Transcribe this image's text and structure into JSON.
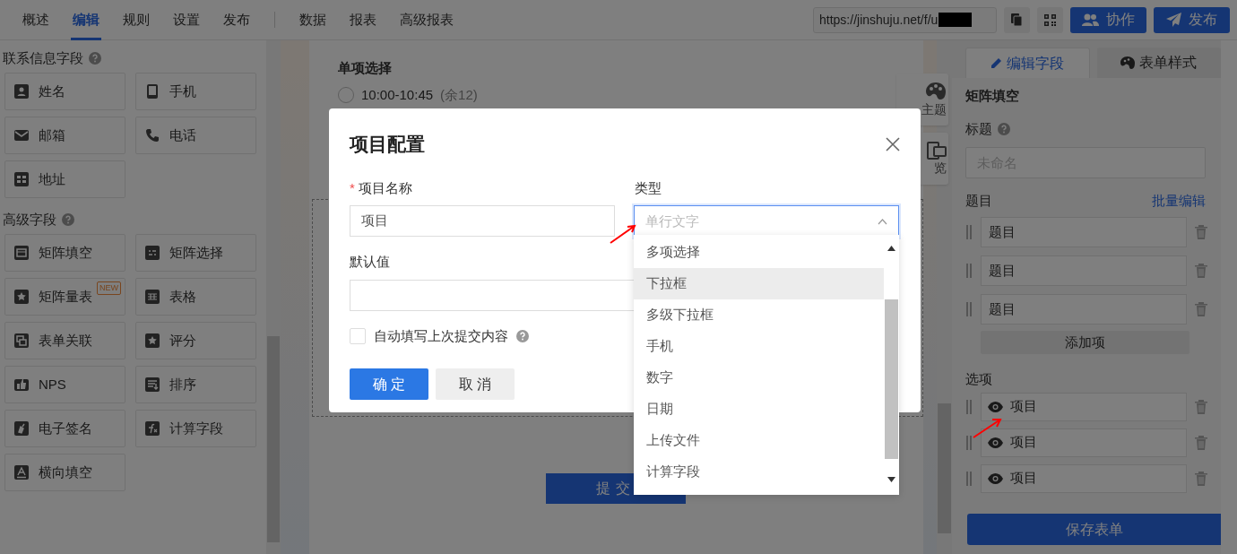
{
  "nav": {
    "primary_tabs": [
      {
        "label": "概述",
        "selected": false
      },
      {
        "label": "编辑",
        "selected": true
      },
      {
        "label": "规则",
        "selected": false
      },
      {
        "label": "设置",
        "selected": false
      },
      {
        "label": "发布",
        "selected": false
      }
    ],
    "data_tabs": [
      {
        "label": "数据",
        "selected": false
      },
      {
        "label": "报表",
        "selected": false
      },
      {
        "label": "高级报表",
        "selected": false
      }
    ],
    "url": "https://jinshuju.net/f/u",
    "actions": [
      {
        "label": "协作",
        "kind": "collaborate"
      },
      {
        "label": "发布",
        "kind": "publish"
      }
    ]
  },
  "left_panel": {
    "sections": [
      {
        "title": "联系信息字段",
        "fields": [
          {
            "label": "姓名"
          },
          {
            "label": "手机"
          },
          {
            "label": "邮箱"
          },
          {
            "label": "电话"
          },
          {
            "label": "地址"
          }
        ]
      },
      {
        "title": "高级字段",
        "fields": [
          {
            "label": "矩阵填空"
          },
          {
            "label": "矩阵选择"
          },
          {
            "label": "矩阵量表",
            "badge": "NEW"
          },
          {
            "label": "表格"
          },
          {
            "label": "表单关联"
          },
          {
            "label": "评分"
          },
          {
            "label": "NPS"
          },
          {
            "label": "排序"
          },
          {
            "label": "电子签名"
          },
          {
            "label": "计算字段"
          },
          {
            "label": "横向填空"
          }
        ]
      }
    ]
  },
  "canvas": {
    "question": "单项选择",
    "option": {
      "label": "10:00-10:45",
      "remaining": "(余12)",
      "selected": false
    },
    "submit": "提交",
    "side_buttons": [
      "主题",
      "览"
    ]
  },
  "modal": {
    "title": "项目配置",
    "name_field": {
      "required_mark": "*",
      "label": "项目名称",
      "value": "项目"
    },
    "type_field": {
      "label": "类型",
      "placeholder": "单行文字",
      "expanded": true
    },
    "default_field": {
      "label": "默认值"
    },
    "auto_fill": {
      "label": "自动填写上次提交内容",
      "checked": false
    },
    "buttons": [
      {
        "label": "确 定",
        "kind": "primary"
      },
      {
        "label": "取 消",
        "kind": "secondary"
      }
    ],
    "options": [
      {
        "label": "多项选择",
        "hovered": false
      },
      {
        "label": "下拉框",
        "hovered": true
      },
      {
        "label": "多级下拉框",
        "hovered": false
      },
      {
        "label": "手机",
        "hovered": false
      },
      {
        "label": "数字",
        "hovered": false
      },
      {
        "label": "日期",
        "hovered": false
      },
      {
        "label": "上传文件",
        "hovered": false
      },
      {
        "label": "计算字段",
        "hovered": false
      }
    ]
  },
  "right_panel": {
    "tabs": [
      {
        "label": "编辑字段",
        "selected": true
      },
      {
        "label": "表单样式",
        "selected": false
      }
    ],
    "field_type": "矩阵填空",
    "title_label": "标题",
    "title_placeholder": "未命名",
    "questions_label": "题目",
    "batch_edit": "批量编辑",
    "questions": [
      "题目",
      "题目",
      "题目"
    ],
    "add_button": "添加项",
    "options_label": "选项",
    "options": [
      {
        "label": "项目",
        "visible": true
      },
      {
        "label": "项目",
        "visible": true
      },
      {
        "label": "项目",
        "visible": true
      }
    ],
    "save": "保存表单"
  }
}
